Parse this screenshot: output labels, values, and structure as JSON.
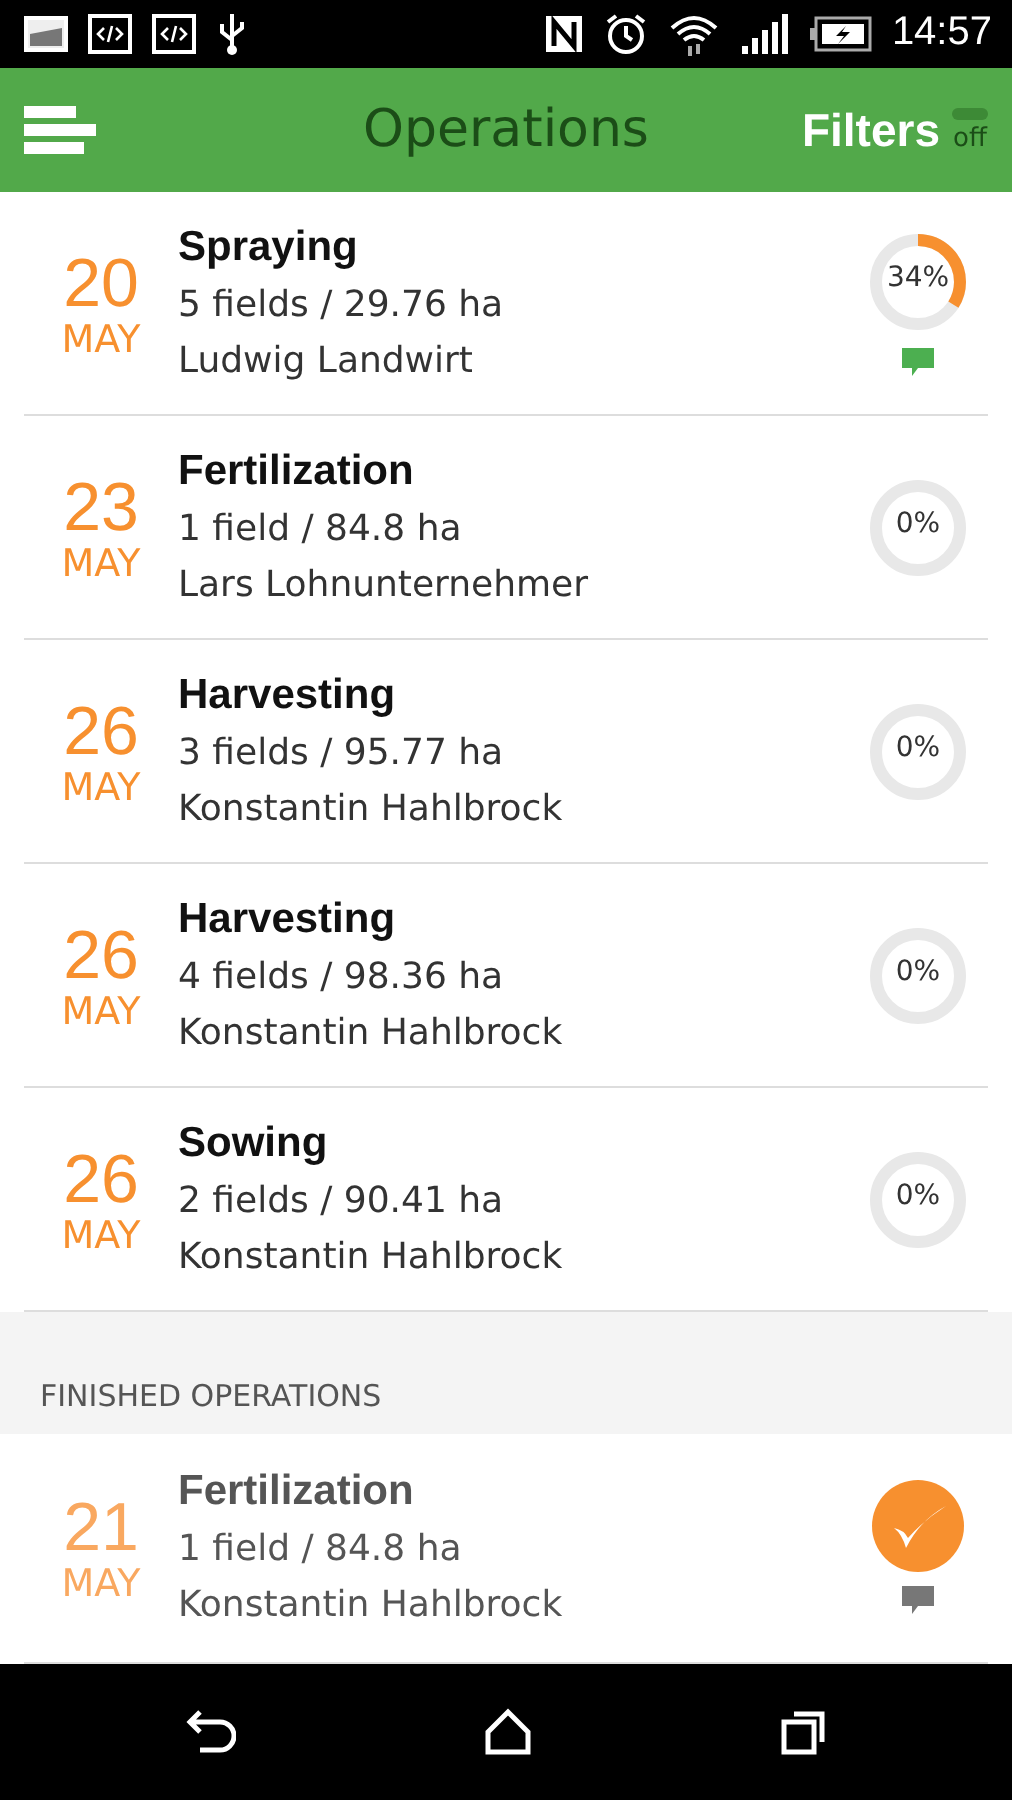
{
  "status_bar": {
    "time": "14:57"
  },
  "app_bar": {
    "title": "Operations",
    "filters_label": "Filters",
    "filters_toggle": {
      "label": "off",
      "on": false
    }
  },
  "operations": [
    {
      "day": "20",
      "month": "MAY",
      "title": "Spraying",
      "summary": "5 fields / 29.76 ha",
      "person": "Ludwig Landwirt",
      "reading": "34%",
      "comment": true
    },
    {
      "day": "23",
      "month": "MAY",
      "title": "Fertilization",
      "summary": "1 field / 84.8 ha",
      "person": "Lars Lohnunternehmer",
      "reading": "0%",
      "comment": false
    },
    {
      "day": "26",
      "month": "MAY",
      "title": "Harvesting",
      "summary": "3 fields / 95.77 ha",
      "person": "Konstantin Hahlbrock",
      "reading": "0%",
      "comment": false
    },
    {
      "day": "26",
      "month": "MAY",
      "title": "Harvesting",
      "summary": "4 fields / 98.36 ha",
      "person": "Konstantin Hahlbrock",
      "reading": "0%",
      "comment": false
    },
    {
      "day": "26",
      "month": "MAY",
      "title": "Sowing",
      "summary": "2 fields / 90.41 ha",
      "person": "Konstantin Hahlbrock",
      "reading": "0%",
      "comment": false
    }
  ],
  "finished": {
    "header": "FINISHED OPERATIONS",
    "items": [
      {
        "day": "21",
        "month": "MAY",
        "title": "Fertilization",
        "summary": "1 field / 84.8 ha",
        "person": "Konstantin Hahlbrock",
        "comment": true
      }
    ]
  }
}
